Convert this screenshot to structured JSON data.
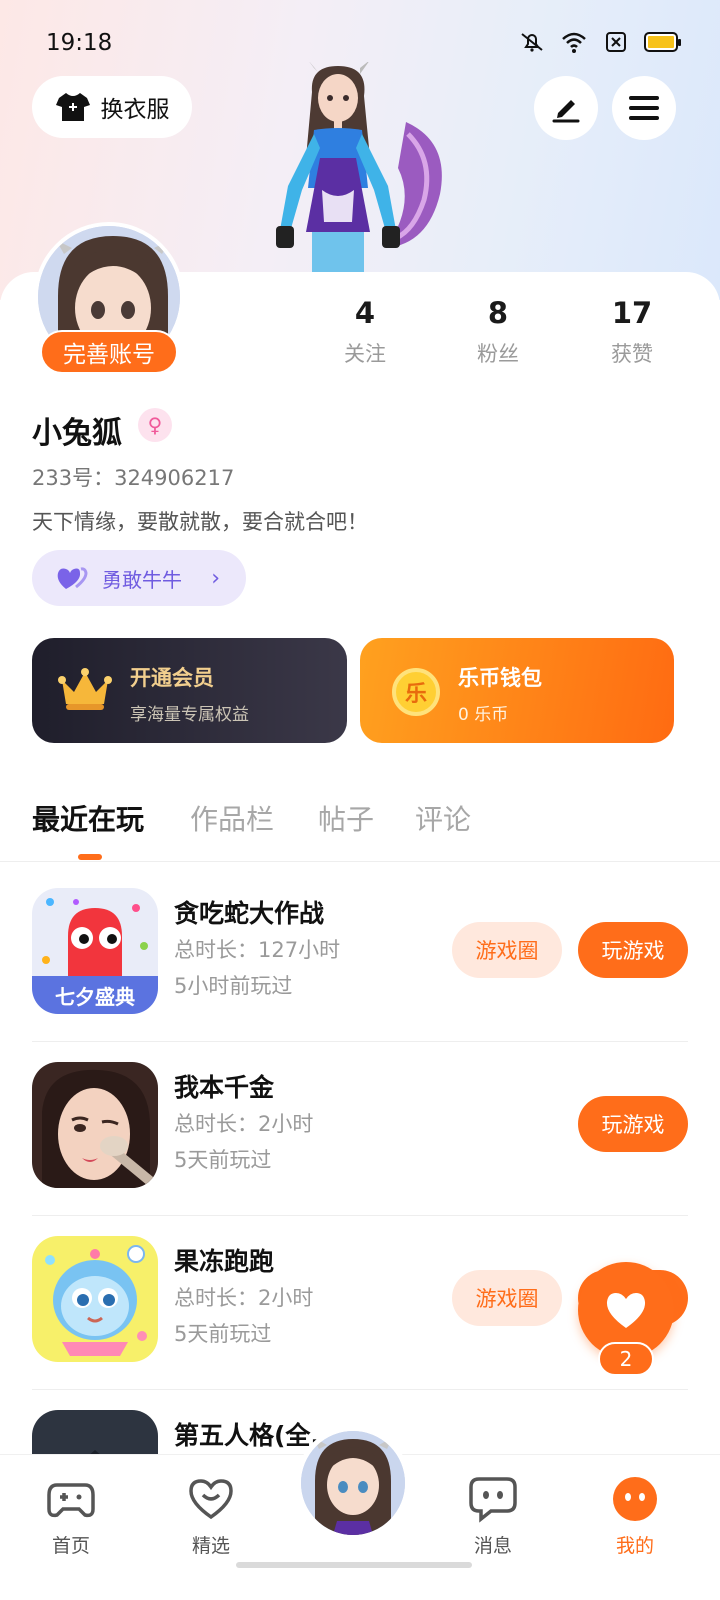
{
  "status_bar": {
    "time": "19:18"
  },
  "header": {
    "outfit_label": "换衣服"
  },
  "profile": {
    "complete_badge": "完善账号",
    "stats": [
      {
        "num": "4",
        "label": "关注"
      },
      {
        "num": "8",
        "label": "粉丝"
      },
      {
        "num": "17",
        "label": "获赞"
      }
    ],
    "username": "小兔狐",
    "gender_symbol": "♀",
    "uid": "233号：324906217",
    "bio": "天下情缘，要散就散，要合就合吧！",
    "tag_label": "勇敢牛牛",
    "tag_chevron": "›"
  },
  "cards": {
    "vip_title": "开通会员",
    "vip_sub": "享海量专属权益",
    "wallet_coin": "乐",
    "wallet_title": "乐币钱包",
    "wallet_sub": "0 乐币"
  },
  "tabs": [
    "最近在玩",
    "作品栏",
    "帖子",
    "评论"
  ],
  "games": [
    {
      "title": "贪吃蛇大作战",
      "duration": "总时长：127小时",
      "last": "5小时前玩过",
      "circle_btn": "游戏圈",
      "play_btn": "玩游戏",
      "icon_text": "七夕盛典"
    },
    {
      "title": "我本千金",
      "duration": "总时长：2小时",
      "last": "5天前玩过",
      "play_btn": "玩游戏"
    },
    {
      "title": "果冻跑跑",
      "duration": "总时长：2小时",
      "last": "5天前玩过",
      "circle_btn": "游戏圈",
      "play_btn": "玩游戏"
    },
    {
      "title": "第五人格(全..."
    }
  ],
  "fab": {
    "count": "2"
  },
  "nav": [
    {
      "label": "首页"
    },
    {
      "label": "精选"
    },
    {
      "label": "消息"
    },
    {
      "label": "我的"
    }
  ],
  "colors": {
    "accent": "#ff6d1a",
    "vip_gold": "#f2cf8e",
    "tag_purple": "#6f5be0"
  }
}
